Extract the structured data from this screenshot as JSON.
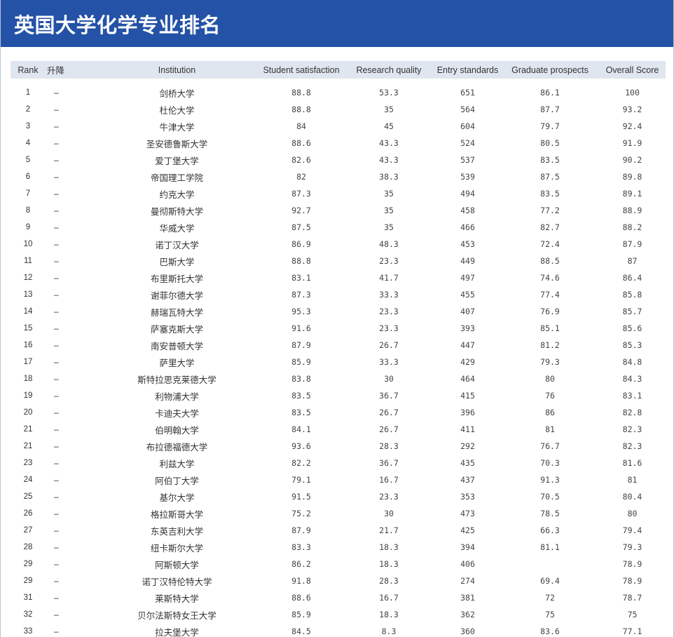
{
  "page_title": "英国大学化学专业排名",
  "columns": {
    "rank": "Rank",
    "change": "升降",
    "institution": "Institution",
    "student_satisfaction": "Student satisfaction",
    "research_quality": "Research quality",
    "entry_standards": "Entry standards",
    "graduate_prospects": "Graduate prospects",
    "overall_score": "Overall Score"
  },
  "rows": [
    {
      "rank": "1",
      "change": "–",
      "institution": "剑桥大学",
      "student_satisfaction": "88.8",
      "research_quality": "53.3",
      "entry_standards": "651",
      "graduate_prospects": "86.1",
      "overall_score": "100"
    },
    {
      "rank": "2",
      "change": "–",
      "institution": "杜伦大学",
      "student_satisfaction": "88.8",
      "research_quality": "35",
      "entry_standards": "564",
      "graduate_prospects": "87.7",
      "overall_score": "93.2"
    },
    {
      "rank": "3",
      "change": "–",
      "institution": "牛津大学",
      "student_satisfaction": "84",
      "research_quality": "45",
      "entry_standards": "604",
      "graduate_prospects": "79.7",
      "overall_score": "92.4"
    },
    {
      "rank": "4",
      "change": "–",
      "institution": "圣安德鲁斯大学",
      "student_satisfaction": "88.6",
      "research_quality": "43.3",
      "entry_standards": "524",
      "graduate_prospects": "80.5",
      "overall_score": "91.9"
    },
    {
      "rank": "5",
      "change": "–",
      "institution": "爱丁堡大学",
      "student_satisfaction": "82.6",
      "research_quality": "43.3",
      "entry_standards": "537",
      "graduate_prospects": "83.5",
      "overall_score": "90.2"
    },
    {
      "rank": "6",
      "change": "–",
      "institution": "帝国理工学院",
      "student_satisfaction": "82",
      "research_quality": "38.3",
      "entry_standards": "539",
      "graduate_prospects": "87.5",
      "overall_score": "89.8"
    },
    {
      "rank": "7",
      "change": "–",
      "institution": "约克大学",
      "student_satisfaction": "87.3",
      "research_quality": "35",
      "entry_standards": "494",
      "graduate_prospects": "83.5",
      "overall_score": "89.1"
    },
    {
      "rank": "8",
      "change": "–",
      "institution": "曼彻斯特大学",
      "student_satisfaction": "92.7",
      "research_quality": "35",
      "entry_standards": "458",
      "graduate_prospects": "77.2",
      "overall_score": "88.9"
    },
    {
      "rank": "9",
      "change": "–",
      "institution": "华威大学",
      "student_satisfaction": "87.5",
      "research_quality": "35",
      "entry_standards": "466",
      "graduate_prospects": "82.7",
      "overall_score": "88.2"
    },
    {
      "rank": "10",
      "change": "–",
      "institution": "诺丁汉大学",
      "student_satisfaction": "86.9",
      "research_quality": "48.3",
      "entry_standards": "453",
      "graduate_prospects": "72.4",
      "overall_score": "87.9"
    },
    {
      "rank": "11",
      "change": "–",
      "institution": "巴斯大学",
      "student_satisfaction": "88.8",
      "research_quality": "23.3",
      "entry_standards": "449",
      "graduate_prospects": "88.5",
      "overall_score": "87"
    },
    {
      "rank": "12",
      "change": "–",
      "institution": "布里斯托大学",
      "student_satisfaction": "83.1",
      "research_quality": "41.7",
      "entry_standards": "497",
      "graduate_prospects": "74.6",
      "overall_score": "86.4"
    },
    {
      "rank": "13",
      "change": "–",
      "institution": "谢菲尔德大学",
      "student_satisfaction": "87.3",
      "research_quality": "33.3",
      "entry_standards": "455",
      "graduate_prospects": "77.4",
      "overall_score": "85.8"
    },
    {
      "rank": "14",
      "change": "–",
      "institution": "赫瑞瓦特大学",
      "student_satisfaction": "95.3",
      "research_quality": "23.3",
      "entry_standards": "407",
      "graduate_prospects": "76.9",
      "overall_score": "85.7"
    },
    {
      "rank": "15",
      "change": "–",
      "institution": "萨塞克斯大学",
      "student_satisfaction": "91.6",
      "research_quality": "23.3",
      "entry_standards": "393",
      "graduate_prospects": "85.1",
      "overall_score": "85.6"
    },
    {
      "rank": "16",
      "change": "–",
      "institution": "南安普顿大学",
      "student_satisfaction": "87.9",
      "research_quality": "26.7",
      "entry_standards": "447",
      "graduate_prospects": "81.2",
      "overall_score": "85.3"
    },
    {
      "rank": "17",
      "change": "–",
      "institution": "萨里大学",
      "student_satisfaction": "85.9",
      "research_quality": "33.3",
      "entry_standards": "429",
      "graduate_prospects": "79.3",
      "overall_score": "84.8"
    },
    {
      "rank": "18",
      "change": "–",
      "institution": "斯特拉思克莱德大学",
      "student_satisfaction": "83.8",
      "research_quality": "30",
      "entry_standards": "464",
      "graduate_prospects": "80",
      "overall_score": "84.3"
    },
    {
      "rank": "19",
      "change": "–",
      "institution": "利物浦大学",
      "student_satisfaction": "83.5",
      "research_quality": "36.7",
      "entry_standards": "415",
      "graduate_prospects": "76",
      "overall_score": "83.1"
    },
    {
      "rank": "20",
      "change": "–",
      "institution": "卡迪夫大学",
      "student_satisfaction": "83.5",
      "research_quality": "26.7",
      "entry_standards": "396",
      "graduate_prospects": "86",
      "overall_score": "82.8"
    },
    {
      "rank": "21",
      "change": "–",
      "institution": "伯明翰大学",
      "student_satisfaction": "84.1",
      "research_quality": "26.7",
      "entry_standards": "411",
      "graduate_prospects": "81",
      "overall_score": "82.3"
    },
    {
      "rank": "21",
      "change": "–",
      "institution": "布拉德福德大学",
      "student_satisfaction": "93.6",
      "research_quality": "28.3",
      "entry_standards": "292",
      "graduate_prospects": "76.7",
      "overall_score": "82.3"
    },
    {
      "rank": "23",
      "change": "–",
      "institution": "利兹大学",
      "student_satisfaction": "82.2",
      "research_quality": "36.7",
      "entry_standards": "435",
      "graduate_prospects": "70.3",
      "overall_score": "81.6"
    },
    {
      "rank": "24",
      "change": "–",
      "institution": "阿伯丁大学",
      "student_satisfaction": "79.1",
      "research_quality": "16.7",
      "entry_standards": "437",
      "graduate_prospects": "91.3",
      "overall_score": "81"
    },
    {
      "rank": "25",
      "change": "–",
      "institution": "基尔大学",
      "student_satisfaction": "91.5",
      "research_quality": "23.3",
      "entry_standards": "353",
      "graduate_prospects": "70.5",
      "overall_score": "80.4"
    },
    {
      "rank": "26",
      "change": "–",
      "institution": "格拉斯哥大学",
      "student_satisfaction": "75.2",
      "research_quality": "30",
      "entry_standards": "473",
      "graduate_prospects": "78.5",
      "overall_score": "80"
    },
    {
      "rank": "27",
      "change": "–",
      "institution": "东英吉利大学",
      "student_satisfaction": "87.9",
      "research_quality": "21.7",
      "entry_standards": "425",
      "graduate_prospects": "66.3",
      "overall_score": "79.4"
    },
    {
      "rank": "28",
      "change": "–",
      "institution": "纽卡斯尔大学",
      "student_satisfaction": "83.3",
      "research_quality": "18.3",
      "entry_standards": "394",
      "graduate_prospects": "81.1",
      "overall_score": "79.3"
    },
    {
      "rank": "29",
      "change": "–",
      "institution": "阿斯顿大学",
      "student_satisfaction": "86.2",
      "research_quality": "18.3",
      "entry_standards": "406",
      "graduate_prospects": "",
      "overall_score": "78.9"
    },
    {
      "rank": "29",
      "change": "–",
      "institution": "诺丁汉特伦特大学",
      "student_satisfaction": "91.8",
      "research_quality": "28.3",
      "entry_standards": "274",
      "graduate_prospects": "69.4",
      "overall_score": "78.9"
    },
    {
      "rank": "31",
      "change": "–",
      "institution": "莱斯特大学",
      "student_satisfaction": "88.6",
      "research_quality": "16.7",
      "entry_standards": "381",
      "graduate_prospects": "72",
      "overall_score": "78.7"
    },
    {
      "rank": "32",
      "change": "–",
      "institution": "贝尔法斯特女王大学",
      "student_satisfaction": "85.9",
      "research_quality": "18.3",
      "entry_standards": "362",
      "graduate_prospects": "75",
      "overall_score": "75"
    },
    {
      "rank": "33",
      "change": "–",
      "institution": "拉夫堡大学",
      "student_satisfaction": "84.5",
      "research_quality": "8.3",
      "entry_standards": "360",
      "graduate_prospects": "83.6",
      "overall_score": "77.1"
    }
  ]
}
